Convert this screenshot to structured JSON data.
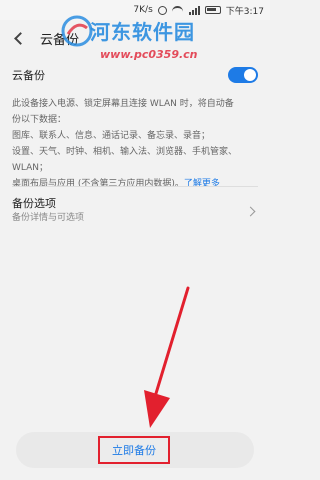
{
  "status_bar": {
    "net_speed": "7K/s",
    "time": "下午3:17"
  },
  "watermark": {
    "title": "河东软件园",
    "url": "www.pc0359.cn"
  },
  "header": {
    "title": "云备份"
  },
  "cloud_backup_toggle": {
    "label": "云备份",
    "state": "on",
    "accent_color": "#1e7be6"
  },
  "description": {
    "lines": [
      "此设备接入电源、锁定屏幕且连接 WLAN 时，将自动备",
      "份以下数据：",
      "图库、联系人、信息、通话记录、备忘录、录音；",
      "设置、天气、时钟、相机、输入法、浏览器、手机管家、",
      "WLAN；"
    ],
    "last_line": "桌面布局与应用 (不含第三方应用内数据)。",
    "learn_more": "了解更多"
  },
  "backup_options": {
    "title": "备份选项",
    "subtitle": "备份详情与可选项"
  },
  "backup_now_button": {
    "label": "立即备份",
    "highlight_color": "#e2202e"
  }
}
